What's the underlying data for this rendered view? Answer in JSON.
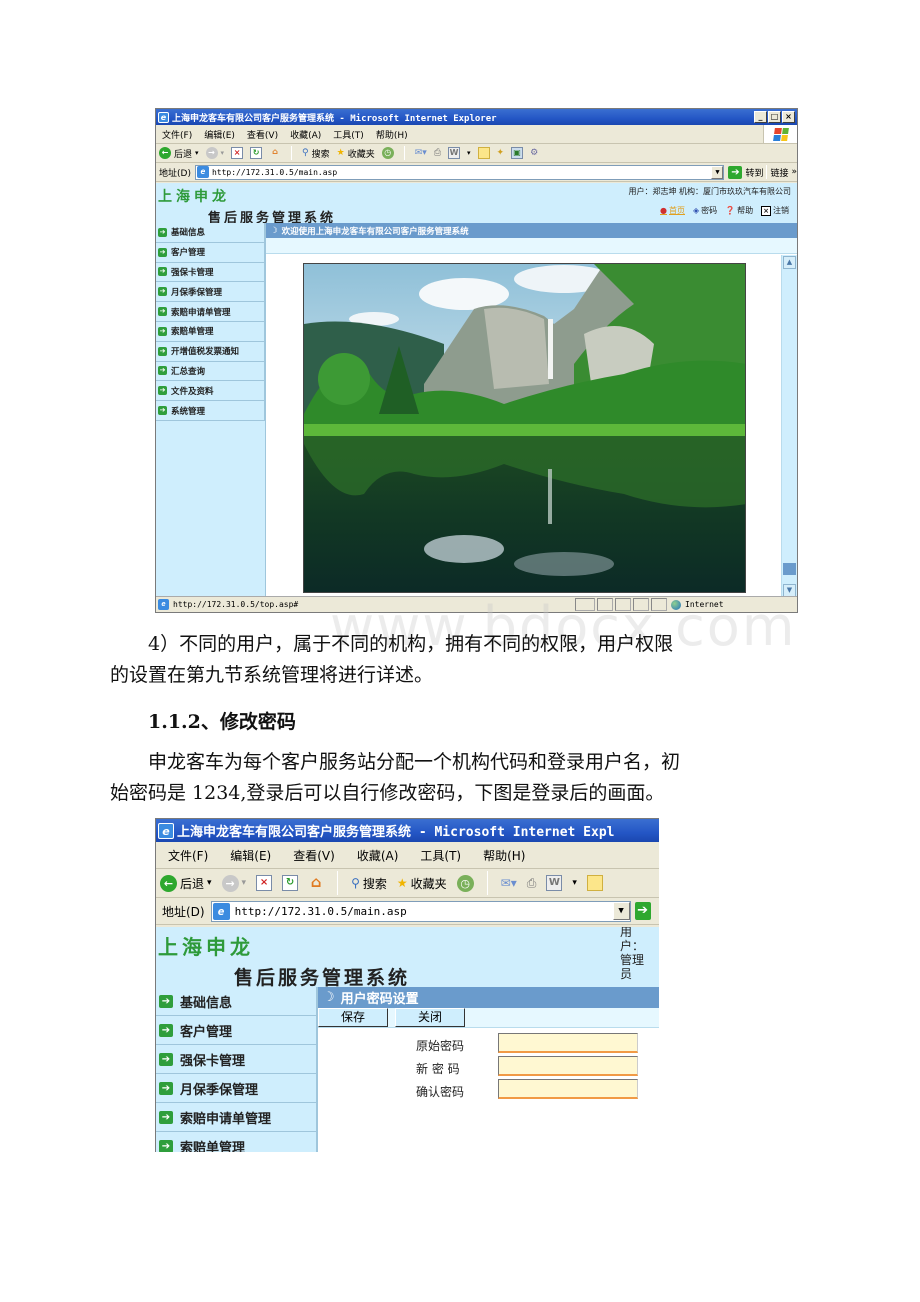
{
  "window1": {
    "title": "上海申龙客车有限公司客户服务管理系统 - Microsoft Internet Explorer",
    "window_buttons": [
      "_",
      "□",
      "×"
    ],
    "menu": [
      "文件(F)",
      "编辑(E)",
      "查看(V)",
      "收藏(A)",
      "工具(T)",
      "帮助(H)"
    ],
    "toolbar": {
      "back": "后退",
      "search": "搜索",
      "favorites": "收藏夹"
    },
    "address_label": "地址(D)",
    "address_value": "http://172.31.0.5/main.asp",
    "go_label": "转到",
    "links_label": "链接",
    "links_chevron": "»",
    "site": {
      "logo": "上海申龙",
      "subtitle": "售后服务管理系统",
      "user_info": "用户：郑志坤    机构：厦门市玖玖汽车有限公司",
      "top_links": [
        "首页",
        "密码",
        "帮助",
        "注销"
      ]
    },
    "sidebar": [
      "基础信息",
      "客户管理",
      "强保卡管理",
      "月保季保管理",
      "索赔申请单管理",
      "索赔单管理",
      "开增值税发票通知",
      "汇总查询",
      "文件及资料",
      "系统管理"
    ],
    "main_header": "欢迎使用上海申龙客车有限公司客户服务管理系统",
    "status_url": "http://172.31.0.5/top.asp#",
    "status_zone": "Internet"
  },
  "document": {
    "para1_line1": "4）不同的用户，属于不同的机构，拥有不同的权限，用户权限",
    "para1_line2": "的设置在第九节系统管理将进行详述。",
    "heading": "1.1.2、修改密码",
    "para2_line1": "申龙客车为每个客户服务站分配一个机构代码和登录用户名，初",
    "para2_line2": "始密码是 1234,登录后可以自行修改密码，下图是登录后的画面。",
    "watermark": "www.bdocx.com"
  },
  "window2": {
    "title": "上海申龙客车有限公司客户服务管理系统 - Microsoft Internet Expl",
    "menu": [
      "文件(F)",
      "编辑(E)",
      "查看(V)",
      "收藏(A)",
      "工具(T)",
      "帮助(H)"
    ],
    "toolbar": {
      "back": "后退",
      "search": "搜索",
      "favorites": "收藏夹"
    },
    "address_label": "地址(D)",
    "address_value": "http://172.31.0.5/main.asp",
    "site": {
      "logo": "上海申龙",
      "subtitle": "售后服务管理系统",
      "user_vertical": "用户：管理员"
    },
    "sidebar": [
      "基础信息",
      "客户管理",
      "强保卡管理",
      "月保季保管理",
      "索赔申请单管理",
      "索赔单管理"
    ],
    "main_header": "用户密码设置",
    "buttons": {
      "save": "保存",
      "close": "关闭"
    },
    "form": {
      "old_password_label": "原始密码",
      "new_password_label": "新 密 码",
      "confirm_password_label": "确认密码",
      "old_password_value": "",
      "new_password_value": "",
      "confirm_password_value": ""
    }
  }
}
